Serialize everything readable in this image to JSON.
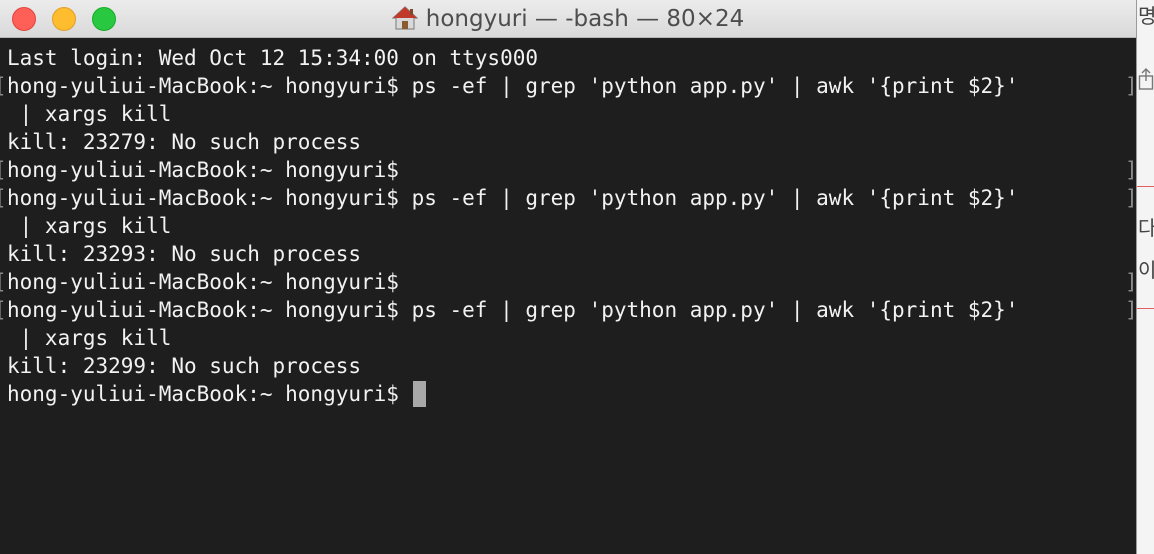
{
  "window": {
    "title": "hongyuri — -bash — 80×24",
    "title_icon": "home-icon"
  },
  "colors": {
    "terminal_bg": "#1e1e1e",
    "terminal_fg": "#f2f2f2",
    "close": "#fe5f57",
    "minimize": "#febc2e",
    "maximize": "#28c840"
  },
  "terminal": {
    "lines": [
      "Last login: Wed Oct 12 15:34:00 on ttys000",
      "hong-yuliui-MacBook:~ hongyuri$ ps -ef | grep 'python app.py' | awk '{print $2}'",
      " | xargs kill",
      "kill: 23279: No such process",
      "hong-yuliui-MacBook:~ hongyuri$",
      "hong-yuliui-MacBook:~ hongyuri$ ps -ef | grep 'python app.py' | awk '{print $2}'",
      " | xargs kill",
      "kill: 23293: No such process",
      "hong-yuliui-MacBook:~ hongyuri$",
      "hong-yuliui-MacBook:~ hongyuri$ ps -ef | grep 'python app.py' | awk '{print $2}'",
      " | xargs kill",
      "kill: 23299: No such process",
      "hong-yuliui-MacBook:~ hongyuri$ "
    ],
    "mark_left": "[",
    "mark_right": "]"
  },
  "behind_window": {
    "fragments": [
      "명",
      "다",
      "이"
    ]
  }
}
